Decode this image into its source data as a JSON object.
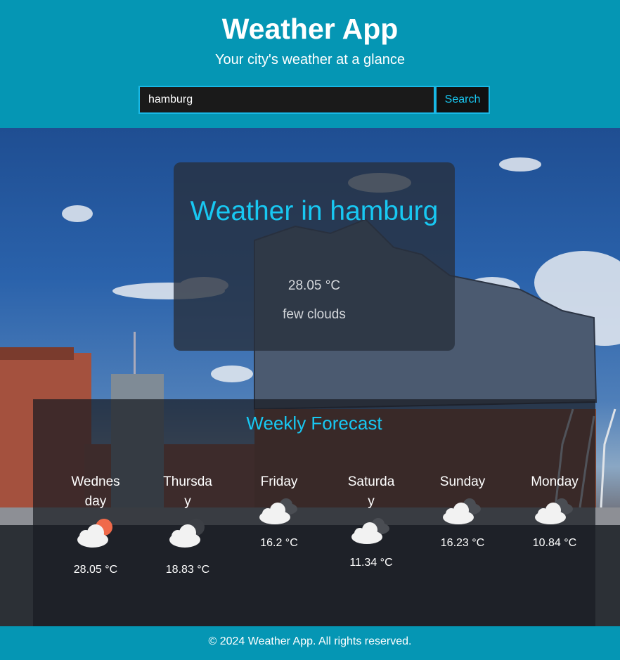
{
  "header": {
    "title": "Weather App",
    "subtitle": "Your city's weather at a glance"
  },
  "search": {
    "value": "hamburg",
    "placeholder": "",
    "button_label": "Search"
  },
  "current": {
    "title": "Weather in hamburg",
    "temperature": "28.05 °C",
    "description": "few clouds"
  },
  "forecast": {
    "title": "Weekly Forecast",
    "days": [
      {
        "name": "Wednesday",
        "icon": "cloud-sun-icon",
        "temp": "28.05 °C"
      },
      {
        "name": "Thursday",
        "icon": "cloud-moon-icon",
        "temp": "18.83 °C"
      },
      {
        "name": "Friday",
        "icon": "broken-clouds-icon",
        "temp": "16.2 °C"
      },
      {
        "name": "Saturday",
        "icon": "broken-clouds-icon",
        "temp": "11.34 °C"
      },
      {
        "name": "Sunday",
        "icon": "broken-clouds-icon",
        "temp": "16.23 °C"
      },
      {
        "name": "Monday",
        "icon": "broken-clouds-icon",
        "temp": "10.84 °C"
      }
    ]
  },
  "footer": {
    "text": "© 2024 Weather App. All rights reserved."
  },
  "colors": {
    "header_bg": "#0596b4",
    "accent": "#18c8f2",
    "sun": "#f06a4a"
  }
}
